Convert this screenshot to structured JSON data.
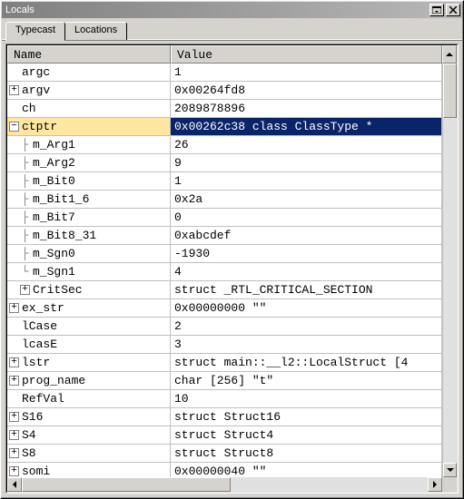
{
  "window": {
    "title": "Locals"
  },
  "tabs": [
    {
      "label": "Typecast",
      "active": true
    },
    {
      "label": "Locations",
      "active": false
    }
  ],
  "columns": {
    "name": "Name",
    "value": "Value"
  },
  "rows": [
    {
      "depth": 0,
      "expander": "none",
      "name": "argc",
      "value": "1"
    },
    {
      "depth": 0,
      "expander": "plus",
      "name": "argv",
      "value": "0x00264fd8"
    },
    {
      "depth": 0,
      "expander": "none",
      "name": "ch",
      "value": "2089878896"
    },
    {
      "depth": 0,
      "expander": "minus",
      "name": "ctptr",
      "value": "0x00262c38 class ClassType *",
      "selected": true
    },
    {
      "depth": 1,
      "expander": "branch",
      "name": "m_Arg1",
      "value": "26"
    },
    {
      "depth": 1,
      "expander": "branch",
      "name": "m_Arg2",
      "value": "9"
    },
    {
      "depth": 1,
      "expander": "branch",
      "name": "m_Bit0",
      "value": "1"
    },
    {
      "depth": 1,
      "expander": "branch",
      "name": "m_Bit1_6",
      "value": "0x2a"
    },
    {
      "depth": 1,
      "expander": "branch",
      "name": "m_Bit7",
      "value": "0"
    },
    {
      "depth": 1,
      "expander": "branch",
      "name": "m_Bit8_31",
      "value": "0xabcdef"
    },
    {
      "depth": 1,
      "expander": "branch",
      "name": "m_Sgn0",
      "value": "-1930"
    },
    {
      "depth": 1,
      "expander": "branchend",
      "name": "m_Sgn1",
      "value": "4"
    },
    {
      "depth": 1,
      "expander": "plus",
      "name": "CritSec",
      "value": "struct _RTL_CRITICAL_SECTION"
    },
    {
      "depth": 0,
      "expander": "plus",
      "name": "ex_str",
      "value": "0x00000000 \"\""
    },
    {
      "depth": 0,
      "expander": "none",
      "name": "lCase",
      "value": "2"
    },
    {
      "depth": 0,
      "expander": "none",
      "name": "lcasE",
      "value": "3"
    },
    {
      "depth": 0,
      "expander": "plus",
      "name": "lstr",
      "value": "struct main::__l2::LocalStruct [4"
    },
    {
      "depth": 0,
      "expander": "plus",
      "name": "prog_name",
      "value": "char [256] \"t\""
    },
    {
      "depth": 0,
      "expander": "none",
      "name": "RefVal",
      "value": "10"
    },
    {
      "depth": 0,
      "expander": "plus",
      "name": "S16",
      "value": "struct Struct16"
    },
    {
      "depth": 0,
      "expander": "plus",
      "name": "S4",
      "value": "struct Struct4"
    },
    {
      "depth": 0,
      "expander": "plus",
      "name": "S8",
      "value": "struct Struct8"
    },
    {
      "depth": 0,
      "expander": "plus",
      "name": "somi",
      "value": "0x00000040 \"\""
    }
  ],
  "icons": {
    "dock": "dock-icon",
    "close": "close-icon",
    "up": "scroll-up-icon",
    "down": "scroll-down-icon",
    "left": "scroll-left-icon",
    "right": "scroll-right-icon"
  }
}
